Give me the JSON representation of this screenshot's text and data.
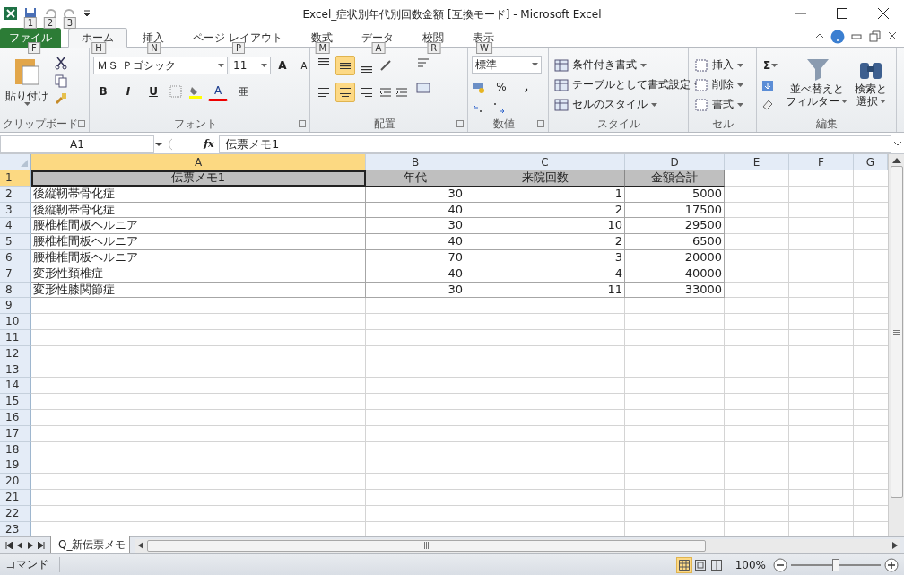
{
  "window": {
    "title": "Excel_症状別年代別回数金額 [互換モード] - Microsoft Excel"
  },
  "quick_access": {
    "keytips": [
      "1",
      "2",
      "3"
    ]
  },
  "tabs": [
    {
      "label": "ファイル",
      "keytip": "F",
      "kind": "file",
      "selected": false
    },
    {
      "label": "ホーム",
      "keytip": "H",
      "kind": "tab",
      "selected": true
    },
    {
      "label": "挿入",
      "keytip": "N",
      "kind": "tab",
      "selected": false
    },
    {
      "label": "ページ レイアウト",
      "keytip": "P",
      "kind": "tab",
      "selected": false
    },
    {
      "label": "数式",
      "keytip": "M",
      "kind": "tab",
      "selected": false
    },
    {
      "label": "データ",
      "keytip": "A",
      "kind": "tab",
      "selected": false
    },
    {
      "label": "校閲",
      "keytip": "R",
      "kind": "tab",
      "selected": false
    },
    {
      "label": "表示",
      "keytip": "W",
      "kind": "tab",
      "selected": false
    }
  ],
  "ribbon": {
    "clipboard": {
      "label": "クリップボード",
      "paste": "貼り付け"
    },
    "font": {
      "label": "フォント",
      "name": "ＭＳ Ｐゴシック",
      "size": "11",
      "grow": "A",
      "shrink": "A",
      "bold": "B",
      "italic": "I",
      "underline": "U",
      "color_letter": "A",
      "phonetic": "亜"
    },
    "alignment": {
      "label": "配置",
      "vertical": [
        {
          "kind": "top",
          "selected": false
        },
        {
          "kind": "middle",
          "selected": true
        },
        {
          "kind": "bottom",
          "selected": false
        }
      ],
      "horizontal": [
        {
          "kind": "left",
          "selected": false
        },
        {
          "kind": "center",
          "selected": true
        },
        {
          "kind": "right",
          "selected": false
        }
      ]
    },
    "number": {
      "label": "数値",
      "format": "標準",
      "percent": "%",
      "comma": ","
    },
    "styles": {
      "label": "スタイル",
      "items": [
        "条件付き書式",
        "テーブルとして書式設定",
        "セルのスタイル"
      ]
    },
    "cells": {
      "label": "セル",
      "items": [
        "挿入",
        "削除",
        "書式"
      ]
    },
    "editing": {
      "label": "編集",
      "sum": "Σ",
      "sort": [
        "並べ替えと",
        "フィルター"
      ],
      "find": [
        "検索と",
        "選択"
      ]
    }
  },
  "formula_bar": {
    "name_box": "A1",
    "fx": "fx",
    "formula": "伝票メモ1"
  },
  "sheet": {
    "columns": [
      {
        "label": "A",
        "selected": true
      },
      {
        "label": "B",
        "selected": false
      },
      {
        "label": "C",
        "selected": false
      },
      {
        "label": "D",
        "selected": false
      },
      {
        "label": "E",
        "selected": false
      },
      {
        "label": "F",
        "selected": false
      },
      {
        "label": "G",
        "selected": false
      }
    ],
    "rows": [
      {
        "label": "1",
        "kind": "header",
        "selected": true,
        "cells": [
          "伝票メモ1",
          "年代",
          "来院回数",
          "金額合計"
        ]
      },
      {
        "label": "2",
        "kind": "data",
        "selected": false,
        "cells": [
          "後縦靭帯骨化症",
          "30",
          "1",
          "5000"
        ]
      },
      {
        "label": "3",
        "kind": "data",
        "selected": false,
        "cells": [
          "後縦靭帯骨化症",
          "40",
          "2",
          "17500"
        ]
      },
      {
        "label": "4",
        "kind": "data",
        "selected": false,
        "cells": [
          "腰椎椎間板ヘルニア",
          "30",
          "10",
          "29500"
        ]
      },
      {
        "label": "5",
        "kind": "data",
        "selected": false,
        "cells": [
          "腰椎椎間板ヘルニア",
          "40",
          "2",
          "6500"
        ]
      },
      {
        "label": "6",
        "kind": "data",
        "selected": false,
        "cells": [
          "腰椎椎間板ヘルニア",
          "70",
          "3",
          "20000"
        ]
      },
      {
        "label": "7",
        "kind": "data",
        "selected": false,
        "cells": [
          "変形性頚椎症",
          "40",
          "4",
          "40000"
        ]
      },
      {
        "label": "8",
        "kind": "data",
        "selected": false,
        "cells": [
          "変形性膝関節症",
          "30",
          "11",
          "33000"
        ]
      },
      {
        "label": "9",
        "kind": "empty",
        "selected": false
      },
      {
        "label": "10",
        "kind": "empty",
        "selected": false
      },
      {
        "label": "11",
        "kind": "empty",
        "selected": false
      },
      {
        "label": "12",
        "kind": "empty",
        "selected": false
      },
      {
        "label": "13",
        "kind": "empty",
        "selected": false
      },
      {
        "label": "14",
        "kind": "empty",
        "selected": false
      },
      {
        "label": "15",
        "kind": "empty",
        "selected": false
      },
      {
        "label": "16",
        "kind": "empty",
        "selected": false
      },
      {
        "label": "17",
        "kind": "empty",
        "selected": false
      },
      {
        "label": "18",
        "kind": "empty",
        "selected": false
      },
      {
        "label": "19",
        "kind": "empty",
        "selected": false
      },
      {
        "label": "20",
        "kind": "empty",
        "selected": false
      },
      {
        "label": "21",
        "kind": "empty",
        "selected": false
      },
      {
        "label": "22",
        "kind": "empty",
        "selected": false
      },
      {
        "label": "23",
        "kind": "empty",
        "selected": false
      }
    ]
  },
  "sheet_tabs": [
    {
      "label": "Q_新伝票メモ",
      "selected": true
    }
  ],
  "status_bar": {
    "mode": "コマンド",
    "zoom": "100%",
    "zoom_level": {
      "level": 0.5
    }
  }
}
